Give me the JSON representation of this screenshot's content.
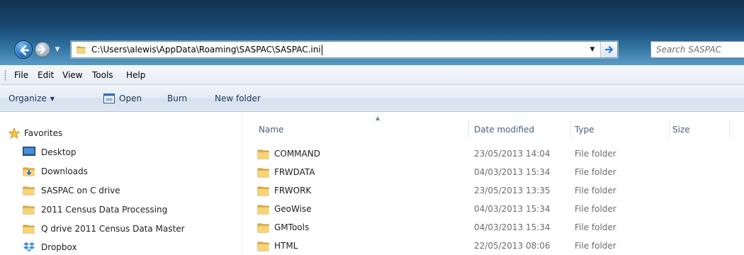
{
  "navigation": {
    "address_path": "C:\\Users\\alewis\\AppData\\Roaming\\SASPAC\\SASPAC.ini",
    "search_placeholder": "Search SASPAC"
  },
  "menubar": {
    "items": [
      "File",
      "Edit",
      "View",
      "Tools",
      "Help"
    ]
  },
  "commandbar": {
    "organize": "Organize",
    "open": "Open",
    "burn": "Burn",
    "new_folder": "New folder"
  },
  "nav_pane": {
    "items": [
      {
        "label": "Favorites",
        "icon": "star-icon"
      },
      {
        "label": "Desktop",
        "icon": "desktop-icon"
      },
      {
        "label": "Downloads",
        "icon": "downloads-folder-icon"
      },
      {
        "label": "SASPAC on C drive",
        "icon": "folder-icon"
      },
      {
        "label": "2011 Census Data Processing",
        "icon": "folder-icon"
      },
      {
        "label": "Q drive 2011 Census Data Master",
        "icon": "folder-icon"
      },
      {
        "label": "Dropbox",
        "icon": "dropbox-icon"
      }
    ]
  },
  "columns": {
    "name": "Name",
    "date_modified": "Date modified",
    "type": "Type",
    "size": "Size"
  },
  "files": [
    {
      "name": "COMMAND",
      "date": "23/05/2013 14:04",
      "type": "File folder"
    },
    {
      "name": "FRWDATA",
      "date": "04/03/2013 15:34",
      "type": "File folder"
    },
    {
      "name": "FRWORK",
      "date": "23/05/2013 13:35",
      "type": "File folder"
    },
    {
      "name": "GeoWise",
      "date": "04/03/2013 15:34",
      "type": "File folder"
    },
    {
      "name": "GMTools",
      "date": "04/03/2013 15:34",
      "type": "File folder"
    },
    {
      "name": "HTML",
      "date": "22/05/2013 08:06",
      "type": "File folder"
    }
  ],
  "colors": {
    "titlebar_dark": "#0b2b4a",
    "titlebar_light": "#5a9cc6",
    "command_text": "#1e395b",
    "folder_yellow": "#f2c55c"
  }
}
